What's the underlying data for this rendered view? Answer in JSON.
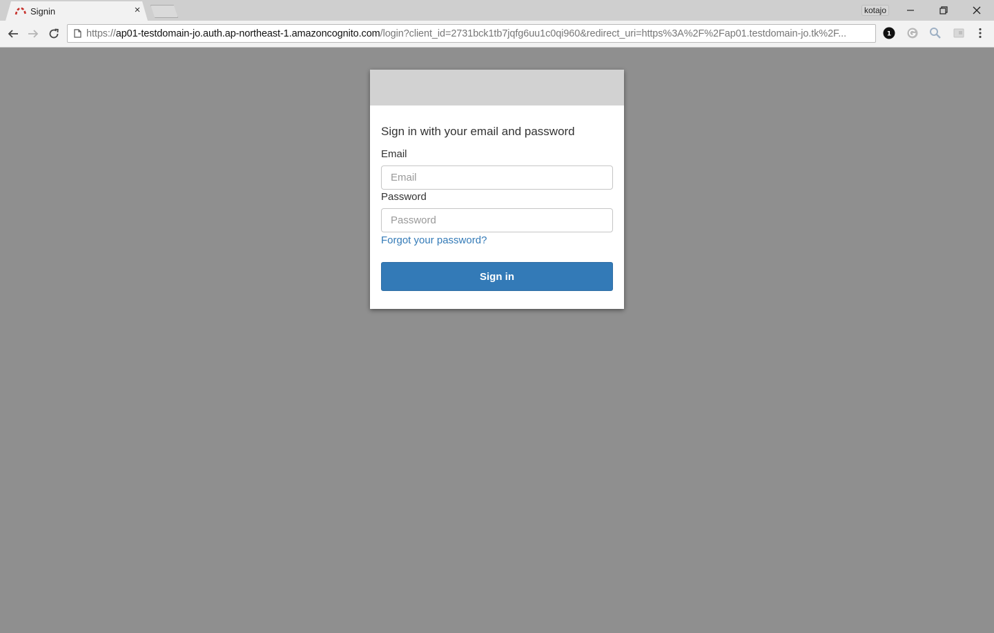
{
  "browser": {
    "tab": {
      "title": "Signin"
    },
    "profile_name": "kotajo",
    "url": {
      "scheme": "https://",
      "host": "ap01-testdomain-jo.auth.ap-northeast-1.amazoncognito.com",
      "path": "/login?client_id=2731bck1tb7jqfg6uu1c0qi960&redirect_uri=https%3A%2F%2Fap01.testdomain-jo.tk%2F..."
    },
    "extensions": [
      {
        "name": "badge-extension-icon",
        "badge": "1"
      },
      {
        "name": "grammar-extension-icon"
      },
      {
        "name": "search-extension-icon"
      },
      {
        "name": "page-extension-icon"
      }
    ]
  },
  "login": {
    "heading": "Sign in with your email and password",
    "email_label": "Email",
    "email_placeholder": "Email",
    "password_label": "Password",
    "password_placeholder": "Password",
    "forgot_link": "Forgot your password?",
    "signin_button": "Sign in"
  },
  "colors": {
    "page_background": "#8f8f8f",
    "banner": "#d2d2d2",
    "primary": "#337ab7"
  }
}
